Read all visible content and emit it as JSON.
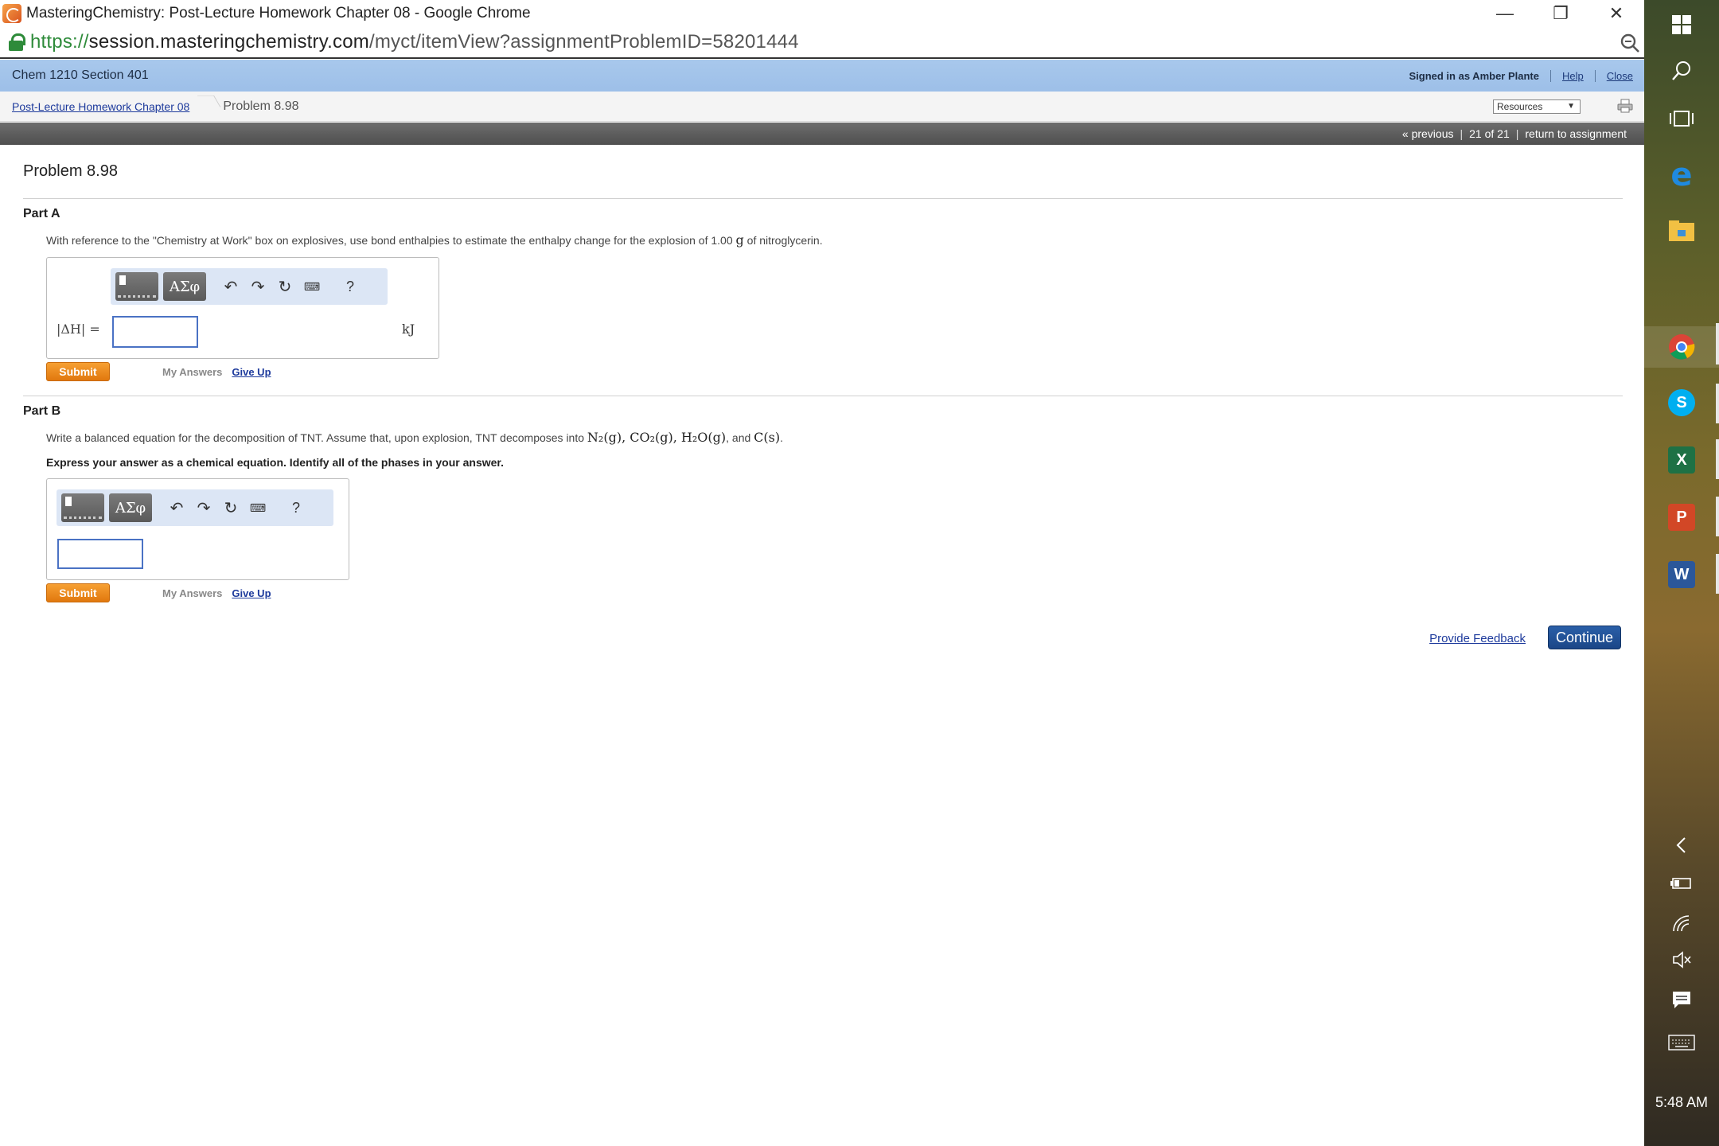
{
  "window": {
    "title": "MasteringChemistry: Post-Lecture Homework Chapter 08 - Google Chrome",
    "minimize": "—",
    "restore": "❐",
    "close": "✕"
  },
  "address": {
    "scheme": "https://",
    "host": "session.masteringchemistry.com",
    "path": "/myct/itemView?assignmentProblemID=58201444"
  },
  "header": {
    "course": "Chem 1210 Section 401",
    "signed_in": "Signed in as Amber Plante",
    "help": "Help",
    "close": "Close"
  },
  "breadcrumb": {
    "assignment": "Post-Lecture Homework Chapter 08",
    "current": "Problem 8.98",
    "resources": "Resources"
  },
  "nav": {
    "previous": "« previous",
    "position": "21 of 21",
    "return": "return to assignment"
  },
  "problem": {
    "title": "Problem 8.98",
    "part_a": {
      "title": "Part A",
      "prompt_pre": "With reference to the \"Chemistry at Work\" box on explosives, use bond enthalpies to estimate the enthalpy change for the explosion of 1.00 ",
      "prompt_unit": "g",
      "prompt_post": " of nitroglycerin.",
      "label": "|ΔH| =",
      "unit": "kJ",
      "input_value": ""
    },
    "part_b": {
      "title": "Part B",
      "prompt_pre": "Write a balanced equation for the decomposition of TNT. Assume that, upon explosion, TNT decomposes into ",
      "prompt_species": "N₂(g), CO₂(g), H₂O(g)",
      "prompt_mid": ", and ",
      "prompt_last": "C(s)",
      "prompt_post": ".",
      "instruction": "Express your answer as a chemical equation. Identify all of the phases in your answer.",
      "input_value": ""
    },
    "toolbar": {
      "greek": "ΑΣφ",
      "undo": "↶",
      "redo": "↷",
      "reset": "↻",
      "keyboard": "⌨",
      "help": "?"
    },
    "submit": "Submit",
    "my_answers": "My Answers",
    "give_up": "Give Up"
  },
  "footer": {
    "feedback": "Provide Feedback",
    "continue": "Continue"
  },
  "taskbar": {
    "time": "5:48 AM",
    "icons": [
      "windows-start-icon",
      "search-icon",
      "task-view-icon",
      "edge-icon",
      "file-explorer-icon",
      "chrome-icon",
      "skype-icon",
      "excel-icon",
      "powerpoint-icon",
      "word-icon",
      "chevron-left-icon",
      "battery-icon",
      "wifi-icon",
      "volume-muted-icon",
      "notification-icon",
      "keyboard-icon"
    ]
  }
}
